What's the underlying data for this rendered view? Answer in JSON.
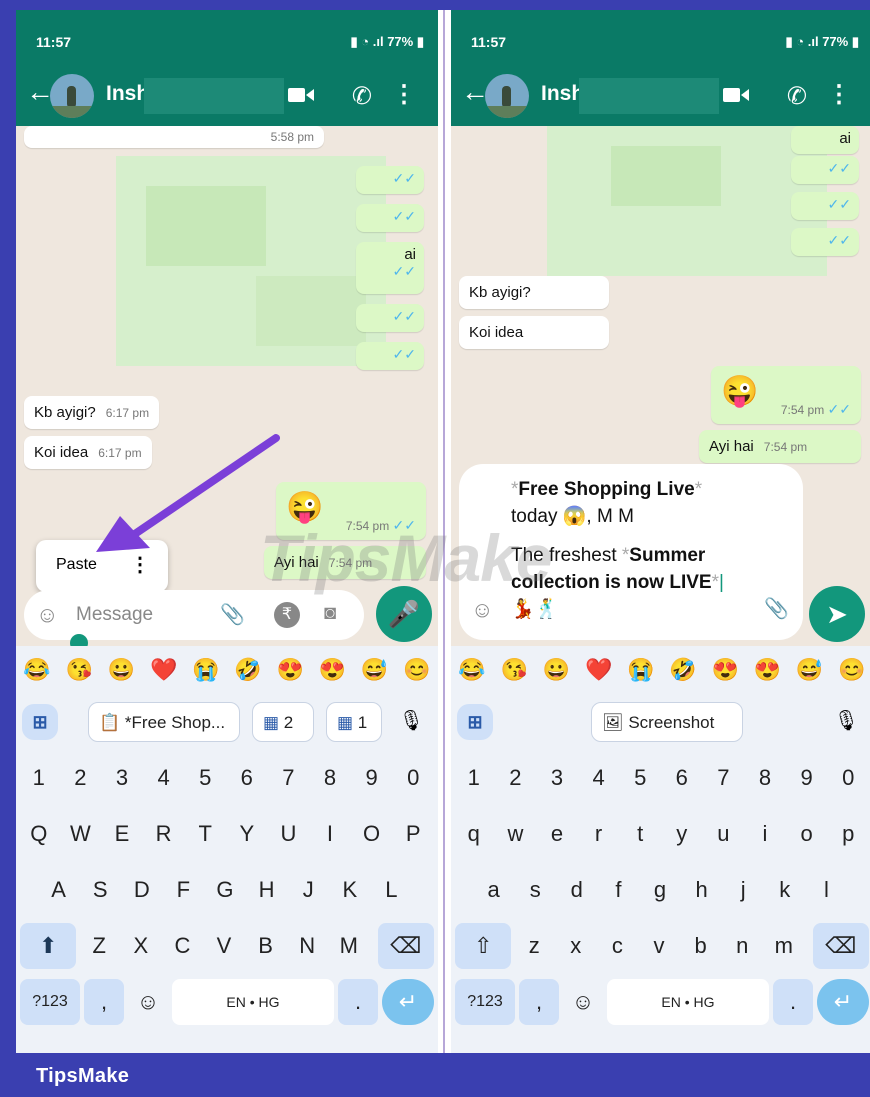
{
  "footer": {
    "brand": "TipsMake"
  },
  "watermark": "TipsMake",
  "left": {
    "status": {
      "time": "11:57",
      "battery": "77%"
    },
    "contact": {
      "name": "Insh"
    },
    "messages": [
      {
        "text": "",
        "time": "5:58 pm",
        "dir": "in"
      },
      {
        "text": "ai",
        "time": "",
        "dir": "out"
      },
      {
        "text": "Kb ayigi?",
        "time": "6:17 pm",
        "dir": "in"
      },
      {
        "text": "Koi idea",
        "time": "6:17 pm",
        "dir": "in"
      },
      {
        "text": "😜",
        "time": "7:54 pm",
        "dir": "out"
      },
      {
        "text": "Ayi hai",
        "time": "7:54 pm",
        "dir": "out"
      }
    ],
    "context_menu": {
      "paste_label": "Paste"
    },
    "input": {
      "placeholder": "Message"
    },
    "suggestions": [
      "*Free Shop...",
      "2",
      "1"
    ],
    "keyboard": {
      "row_numbers": [
        "1",
        "2",
        "3",
        "4",
        "5",
        "6",
        "7",
        "8",
        "9",
        "0"
      ],
      "row1": [
        "Q",
        "W",
        "E",
        "R",
        "T",
        "Y",
        "U",
        "I",
        "O",
        "P"
      ],
      "row2": [
        "A",
        "S",
        "D",
        "F",
        "G",
        "H",
        "J",
        "K",
        "L"
      ],
      "row3": [
        "Z",
        "X",
        "C",
        "V",
        "B",
        "N",
        "M"
      ],
      "sym_label": "?123",
      "comma": ",",
      "space_label": "EN • HG",
      "period": "."
    }
  },
  "right": {
    "status": {
      "time": "11:57",
      "battery": "77%"
    },
    "contact": {
      "name": "Insh"
    },
    "messages": [
      {
        "text": "ai",
        "time": "",
        "dir": "out"
      },
      {
        "text": "Kb ayigi?",
        "time": "",
        "dir": "in"
      },
      {
        "text": "Koi idea",
        "time": "",
        "dir": "in"
      },
      {
        "text": "😜",
        "time": "7:54 pm",
        "dir": "out"
      },
      {
        "text": "Ayi hai",
        "time": "7:54 pm",
        "dir": "out"
      }
    ],
    "compose": {
      "line1_bold": "Free Shopping Live",
      "line2": "today 😱, M M",
      "line3_plain": "The freshest ",
      "line3_bold": "Summer",
      "line4_bold": "collection is now LIVE",
      "line5": "💃🕺"
    },
    "suggestions": [
      "Screenshot"
    ],
    "keyboard": {
      "row_numbers": [
        "1",
        "2",
        "3",
        "4",
        "5",
        "6",
        "7",
        "8",
        "9",
        "0"
      ],
      "row1": [
        "q",
        "w",
        "e",
        "r",
        "t",
        "y",
        "u",
        "i",
        "o",
        "p"
      ],
      "row2": [
        "a",
        "s",
        "d",
        "f",
        "g",
        "h",
        "j",
        "k",
        "l"
      ],
      "row3": [
        "z",
        "x",
        "c",
        "v",
        "b",
        "n",
        "m"
      ],
      "sym_label": "?123",
      "comma": ",",
      "space_label": "EN • HG",
      "period": "."
    }
  },
  "emoji_row": [
    "😂",
    "😘",
    "😀",
    "❤️",
    "😭",
    "🤣",
    "😍",
    "😍",
    "😅",
    "😊"
  ]
}
